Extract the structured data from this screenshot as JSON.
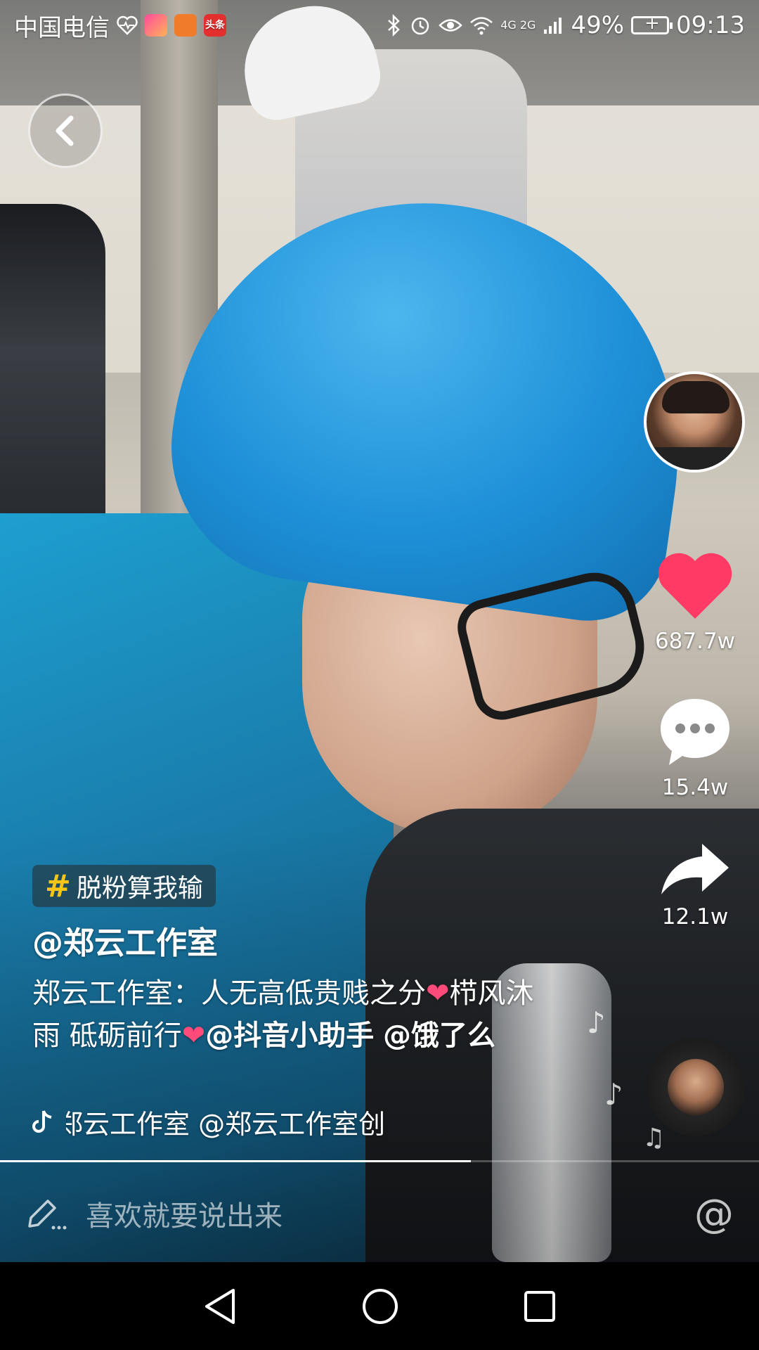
{
  "status_bar": {
    "carrier": "中国电信",
    "app_icons": [
      "heart-pulse-icon",
      "video-app-icon",
      "orange-app-icon",
      "toutiao-app-icon"
    ],
    "toutiao_label": "头条",
    "network": "4G 2G",
    "battery": "49%",
    "time": "09:13"
  },
  "video": {
    "hashtag": "脱粉算我输",
    "author": "@郑云工作室",
    "description": {
      "part1": "郑云工作室：人无高低贵贱之分",
      "part2": "栉风沐雨 砥砺前行",
      "mention1": "@抖音小助手",
      "mention2": "@饿了么"
    },
    "music_text": "郑云工作室    @郑云工作室创"
  },
  "actions": {
    "likes": "687.7w",
    "comments": "15.4w",
    "shares": "12.1w"
  },
  "progress": 0.62,
  "comment_input": {
    "placeholder": "喜欢就要说出来",
    "at_symbol": "@"
  },
  "colors": {
    "like_red": "#ff3a64",
    "hashtag_yellow": "#f5c518",
    "heart_pink": "#ff4b7a"
  }
}
